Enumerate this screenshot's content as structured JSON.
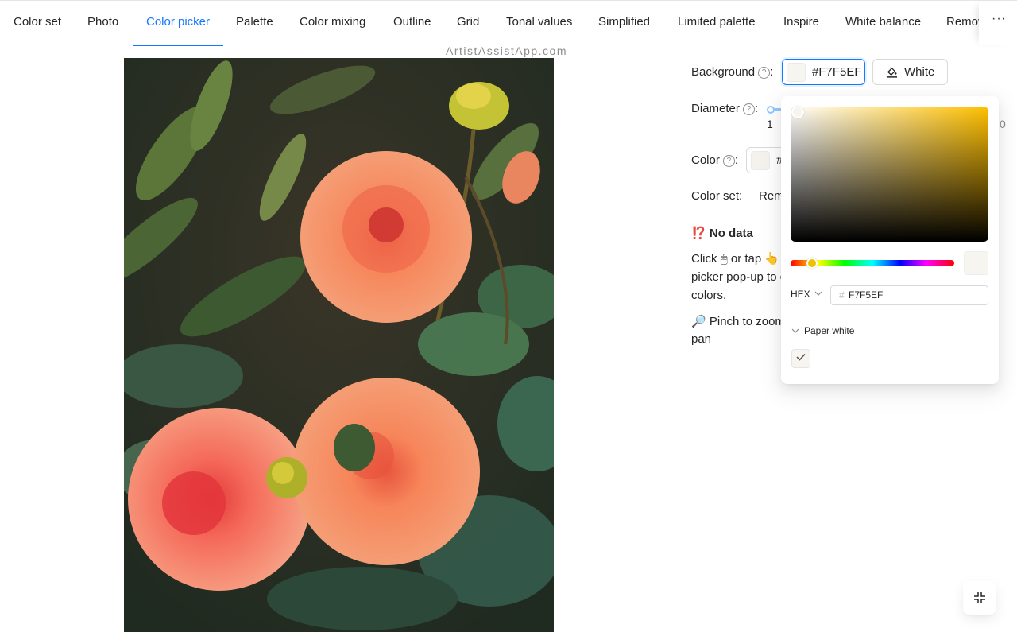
{
  "tabs": {
    "items": [
      "Color set",
      "Photo",
      "Color picker",
      "Palette",
      "Color mixing",
      "Outline",
      "Grid",
      "Tonal values",
      "Simplified",
      "Limited palette",
      "Inspire",
      "White balance",
      "Remov"
    ],
    "active": "Color picker",
    "more_label": "···"
  },
  "watermark": "ArtistAssistApp.com",
  "settings": {
    "background_label": "Background",
    "background_value": "#F7F5EF",
    "white_button": "White",
    "diameter_label": "Diameter",
    "diameter_min": "1",
    "diameter_max": "0",
    "color_label": "Color",
    "color_value_partial": "#",
    "color_set_label": "Color set",
    "color_set_value_partial": "Rem",
    "help_glyph": "?"
  },
  "info": {
    "no_data_icon": "⁉️",
    "no_data": "No data",
    "click_text_1": "Click",
    "click_text_2": "or tap",
    "click_line_2": "picker pop-up to c",
    "click_line_3": "colors.",
    "zoom_line_1": "Pinch to zoom",
    "zoom_line_2": "pan"
  },
  "picker": {
    "format": "HEX",
    "hex_value": "F7F5EF",
    "hash": "#",
    "preset_label": "Paper white"
  },
  "colors": {
    "accent": "#1677ff",
    "paper_white": "#F7F5EF"
  },
  "icons": {
    "help": "question-circle-icon",
    "paint_bucket": "bg-colors-icon",
    "mouse": "mouse-icon",
    "pointer": "pointing-hand-icon",
    "magnifier": "magnifier-icon",
    "check": "check-icon",
    "chevron": "chevron-down-icon",
    "fullscreen_exit": "fullscreen-exit-icon"
  }
}
